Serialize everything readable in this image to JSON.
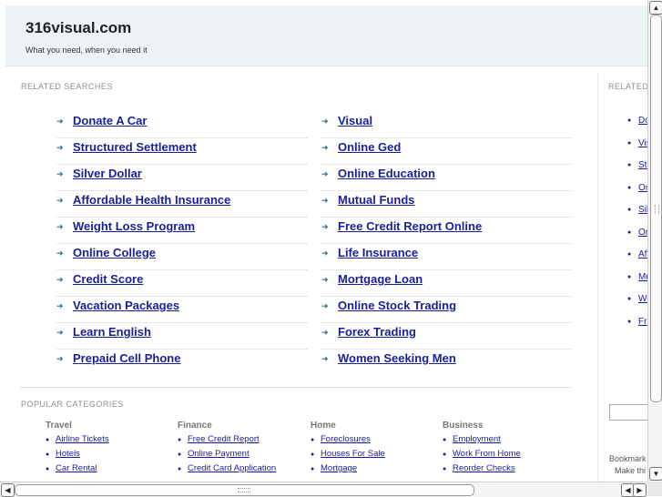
{
  "header": {
    "title": "316visual.com",
    "tagline": "What you need, when you need it"
  },
  "related": {
    "label": "RELATED SEARCHES",
    "left": [
      "Donate A Car",
      "Structured Settlement",
      "Silver Dollar",
      "Affordable Health Insurance",
      "Weight Loss Program",
      "Online College",
      "Credit Score",
      "Vacation Packages",
      "Learn English",
      "Prepaid Cell Phone"
    ],
    "right": [
      "Visual",
      "Online Ged",
      "Online Education",
      "Mutual Funds",
      "Free Credit Report Online",
      "Life Insurance",
      "Mortgage Loan",
      "Online Stock Trading",
      "Forex Trading",
      "Women Seeking Men"
    ]
  },
  "popular": {
    "label": "POPULAR CATEGORIES",
    "columns": [
      {
        "title": "Travel",
        "items": [
          "Airline Tickets",
          "Hotels",
          "Car Rental"
        ]
      },
      {
        "title": "Finance",
        "items": [
          "Free Credit Report",
          "Online Payment",
          "Credit Card Application"
        ]
      },
      {
        "title": "Home",
        "items": [
          "Foreclosures",
          "Houses For Sale",
          "Mortgage"
        ]
      },
      {
        "title": "Business",
        "items": [
          "Employment",
          "Work From Home",
          "Reorder Checks"
        ]
      }
    ]
  },
  "sidebar": {
    "label": "RELATED",
    "items": [
      "Do",
      "Vis",
      "Str",
      "On",
      "Sil",
      "On",
      "Aff",
      "Mu",
      "We",
      "Fre"
    ],
    "bookmark": "Bookmark",
    "make_this": "Make thi"
  },
  "icons": {
    "arrow": "arrow-right-icon",
    "bullet": "bullet-icon"
  },
  "colors": {
    "link": "#1a1f99",
    "header_bg": "#eef3f6",
    "accent": "#2a6f9b"
  }
}
